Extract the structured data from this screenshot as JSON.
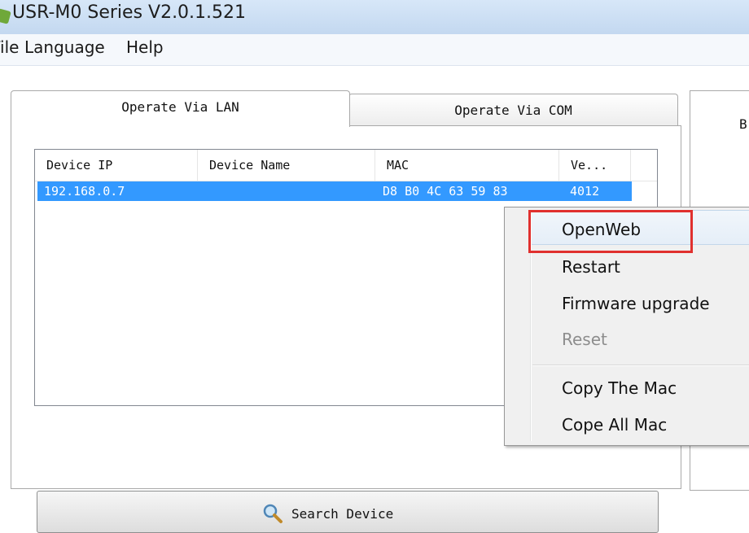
{
  "window": {
    "title": "USR-M0 Series V2.0.1.521"
  },
  "menubar": {
    "file": "File",
    "language": "Language",
    "help": "Help"
  },
  "tabs": {
    "lan": "Operate Via LAN",
    "com": "Operate Via COM"
  },
  "table": {
    "columns": [
      "Device IP",
      "Device Name",
      "MAC",
      "Ve..."
    ],
    "rows": [
      {
        "ip": "192.168.0.7",
        "name": "",
        "mac": "D8 B0 4C 63 59 83",
        "version": "4012"
      }
    ]
  },
  "search_button": {
    "label": "Search Device"
  },
  "right_panel": {
    "label": "B"
  },
  "context_menu": {
    "items": [
      "OpenWeb",
      "Restart",
      "Firmware upgrade",
      "Reset",
      "Copy The Mac",
      "Cope All Mac"
    ]
  },
  "colors": {
    "selection": "#3399ff",
    "highlight_box": "#e0302e"
  }
}
